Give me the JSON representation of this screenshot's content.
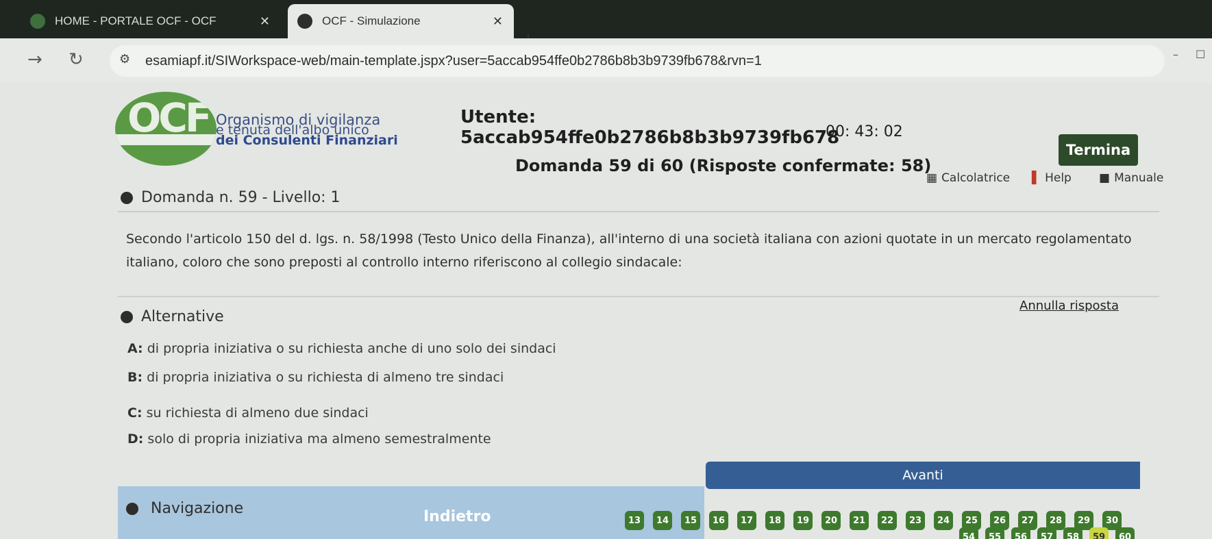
{
  "browser": {
    "tabs": [
      {
        "title": "HOME - PORTALE OCF - OCF",
        "active": false
      },
      {
        "title": "OCF - Simulazione",
        "active": true
      }
    ],
    "url": "esamiapf.it/SIWorkspace-web/main-template.jspx?user=5accab954ffe0b2786b8b3b9739fb678&rvn=1"
  },
  "header": {
    "logo_text": "OCF",
    "org_line1": "Organismo di vigilanza",
    "org_line2": "e tenuta dell'albo unico",
    "org_line3": "dei Consulenti Finanziari",
    "utente_label": "Utente:",
    "utente_value": "5accab954ffe0b2786b8b3b9739fb678",
    "timer": "00: 43: 02",
    "termina": "Termina",
    "domanda_count": "Domanda 59 di 60 (Risposte confermate: 58)",
    "tools": [
      {
        "label": "Calcolatrice",
        "icon": "calculator-icon"
      },
      {
        "label": "Help",
        "icon": "help-icon"
      },
      {
        "label": "Manuale",
        "icon": "book-icon"
      }
    ]
  },
  "question": {
    "title": "Domanda n. 59 - Livello: 1",
    "text": "Secondo l'articolo 150 del d. lgs. n. 58/1998 (Testo Unico della Finanza), all'interno di una società italiana con azioni quotate in un mercato regolamentato italiano, coloro che sono preposti al controllo interno riferiscono al collegio sindacale:"
  },
  "alternatives": {
    "title": "Alternative",
    "annulla": "Annulla risposta",
    "items": [
      {
        "key": "A:",
        "text": "di propria iniziativa o su richiesta anche di uno solo dei sindaci"
      },
      {
        "key": "B:",
        "text": "di propria iniziativa o su richiesta di almeno tre sindaci"
      },
      {
        "key": "C:",
        "text": "su richiesta di almeno due sindaci"
      },
      {
        "key": "D:",
        "text": "solo di propria iniziativa ma almeno semestralmente"
      }
    ]
  },
  "navigation": {
    "title": "Navigazione",
    "avanti": "Avanti",
    "indietro": "Indietro",
    "pages_row1": [
      "13",
      "14",
      "15",
      "16",
      "17",
      "18",
      "19",
      "20",
      "21",
      "22",
      "23",
      "24",
      "25",
      "26",
      "27",
      "28",
      "29",
      "30"
    ],
    "pages_row2": [
      "54",
      "55",
      "56",
      "57",
      "58",
      "59",
      "60"
    ],
    "current_page": "59"
  }
}
